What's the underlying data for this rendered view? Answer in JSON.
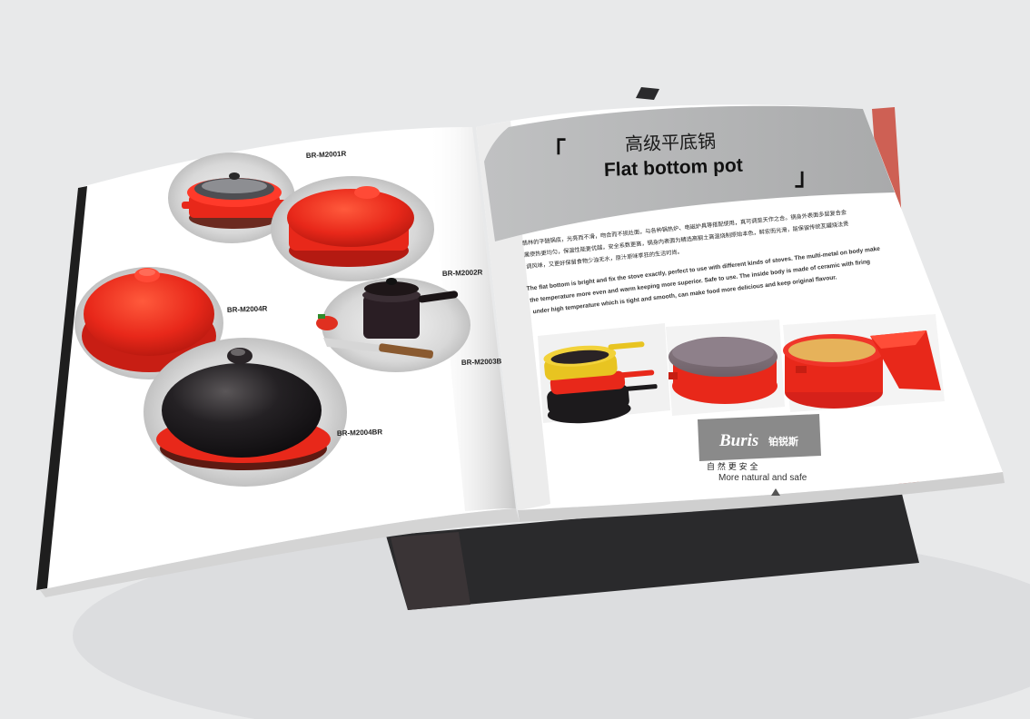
{
  "catalog": {
    "left_page": {
      "products": [
        {
          "code": "BR-M2001R"
        },
        {
          "code": "BR-M2002R"
        },
        {
          "code": "BR-M2004R"
        },
        {
          "code": "BR-M2003B"
        },
        {
          "code": "BR-M2004BR"
        }
      ]
    },
    "right_page": {
      "header": {
        "bracket_open": "「",
        "title_cn": "高级平底锅",
        "title_en": "Flat bottom pot",
        "bracket_close": "」"
      },
      "description_cn": [
        "翡林的平醚锅底，光亮而不滑，吻合而不损灶面，与各种锅热炉、电磁炉具等搭配使用，真可调是天作之合。锅身外表面多层复合金",
        "属使热更均匀，保温性能更优越，安全系数更高，锅身内表面为精选高钢土高温烧制原始本色，鲜宏而光滑，能保留传统瓦罐烧法煲",
        "调风味，又更好保留食物少油无水，原汁原味享狂的生活时尚。"
      ],
      "description_en": [
        "The flat bottom is bright and fix the stove exactly, perfect to use with different kinds of stoves. The multi-metal on body make",
        "the temperature more even and warm keeping more superior. Safe to use. The inside body is made of ceramic with firing",
        "under high temperature which is tight and smooth, can make food more delicious and keep original flavour."
      ],
      "brand": {
        "logo_en": "Buris",
        "logo_cn": "铂锐斯",
        "slogan_cn": "自 然 更 安 全",
        "slogan_en": "More natural and safe"
      }
    }
  },
  "colors": {
    "background": "#e8e9ea",
    "pot_red": "#e8281a",
    "pot_black": "#1c1a1c",
    "header_gray": "#b1b2b3",
    "logo_gray": "#8a8a8a"
  }
}
